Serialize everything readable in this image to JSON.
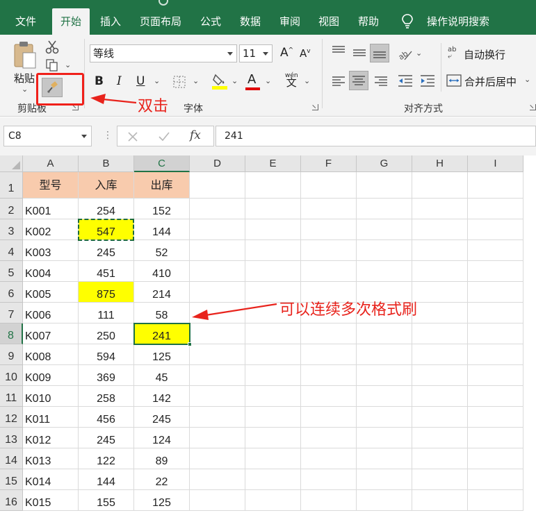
{
  "ribbon_tabs": [
    {
      "label": "文件",
      "active": false
    },
    {
      "label": "开始",
      "active": true
    },
    {
      "label": "插入",
      "active": false
    },
    {
      "label": "页面布局",
      "active": false
    },
    {
      "label": "公式",
      "active": false
    },
    {
      "label": "数据",
      "active": false
    },
    {
      "label": "审阅",
      "active": false
    },
    {
      "label": "视图",
      "active": false
    },
    {
      "label": "帮助",
      "active": false
    }
  ],
  "tell_me": {
    "label": "操作说明搜索",
    "icon": "lightbulb-icon"
  },
  "clipboard": {
    "paste_label": "粘贴",
    "group_label": "剪贴板",
    "cut_icon": "scissors-icon",
    "copy_icon": "copy-icon",
    "format_painter_icon": "format-painter-icon"
  },
  "font": {
    "font_name": "等线",
    "font_size": "11",
    "group_label": "字体",
    "bold": "B",
    "italic": "I",
    "underline": "U",
    "font_color_glyph": "A",
    "phonetic_glyph": "wén",
    "phonetic_glyph2": "文",
    "highlight_color": "#ffff00",
    "font_color": "#e00000"
  },
  "alignment": {
    "wrap_text_label": "自动换行",
    "merge_label": "合并后居中",
    "group_label": "对齐方式",
    "wrap_icon_text": "ab"
  },
  "formula_bar": {
    "name_box": "C8",
    "fx": "fx",
    "value": "241"
  },
  "sheet": {
    "columns": [
      "A",
      "B",
      "C",
      "D",
      "E",
      "F",
      "G",
      "H",
      "I"
    ],
    "selected_column": "C",
    "selected_row": 8,
    "header_row": [
      "型号",
      "入库",
      "出库"
    ],
    "rows": [
      {
        "n": "1"
      },
      {
        "n": "2",
        "a": "K001",
        "b": "254",
        "c": "152"
      },
      {
        "n": "3",
        "a": "K002",
        "b": "547",
        "c": "144",
        "b_yellow": true
      },
      {
        "n": "4",
        "a": "K003",
        "b": "245",
        "c": "52"
      },
      {
        "n": "5",
        "a": "K004",
        "b": "451",
        "c": "410"
      },
      {
        "n": "6",
        "a": "K005",
        "b": "875",
        "c": "214",
        "b_yellow": true
      },
      {
        "n": "7",
        "a": "K006",
        "b": "111",
        "c": "58"
      },
      {
        "n": "8",
        "a": "K007",
        "b": "250",
        "c": "241",
        "c_yellow": true
      },
      {
        "n": "9",
        "a": "K008",
        "b": "594",
        "c": "125"
      },
      {
        "n": "10",
        "a": "K009",
        "b": "369",
        "c": "45"
      },
      {
        "n": "11",
        "a": "K010",
        "b": "258",
        "c": "142"
      },
      {
        "n": "12",
        "a": "K011",
        "b": "456",
        "c": "245"
      },
      {
        "n": "13",
        "a": "K012",
        "b": "245",
        "c": "124"
      },
      {
        "n": "14",
        "a": "K013",
        "b": "122",
        "c": "89"
      },
      {
        "n": "15",
        "a": "K014",
        "b": "144",
        "c": "22"
      },
      {
        "n": "16",
        "a": "K015",
        "b": "155",
        "c": "125"
      }
    ],
    "header_fill": "#f8cbad",
    "highlight_fill": "#ffff00"
  },
  "annotations": {
    "double_click": "双击",
    "multi_use": "可以连续多次格式刷",
    "color": "#e8231c"
  }
}
